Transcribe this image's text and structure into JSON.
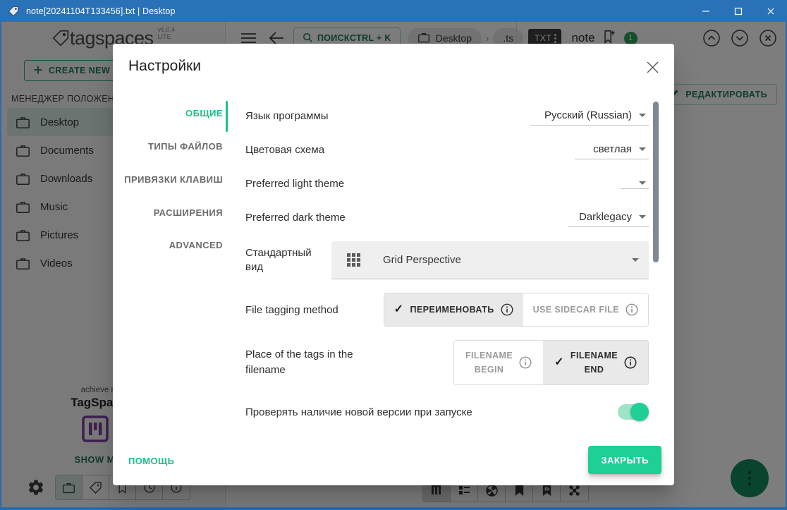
{
  "window": {
    "title": "note[20241104T133456].txt | Desktop",
    "icon": "tag-icon",
    "controls": {
      "minimize": "minimize-icon",
      "maximize": "maximize-icon",
      "close": "close-icon"
    },
    "titlebar_color": "#2a72b8"
  },
  "app": {
    "logo_text": "tagspaces",
    "version": "v6.0.4",
    "edition": "LITE",
    "create_new_label": "CREATE NEW",
    "locations_title": "МЕНЕДЖЕР ПОЛОЖЕНИЙ",
    "locations": [
      {
        "label": "Desktop",
        "icon": "briefcase-icon",
        "selected": true
      },
      {
        "label": "Documents",
        "icon": "briefcase-icon",
        "selected": false
      },
      {
        "label": "Downloads",
        "icon": "briefcase-icon",
        "selected": false
      },
      {
        "label": "Music",
        "icon": "briefcase-icon",
        "selected": false
      },
      {
        "label": "Pictures",
        "icon": "briefcase-icon",
        "selected": false
      },
      {
        "label": "Videos",
        "icon": "briefcase-icon",
        "selected": false
      }
    ],
    "promo": {
      "line1": "achieve more with",
      "line2": "TagSpaces Pro",
      "cta": "SHOW ME MORE"
    },
    "toolbar": {
      "menu_icon": "hamburger-menu-icon",
      "back_icon": "arrow-left-icon",
      "search_label": "ПОИСКCTRL + K",
      "search_icon": "search-icon",
      "breadcrumb": [
        {
          "label": "Desktop",
          "icon": "briefcase-icon"
        },
        {
          "label": ".ts",
          "icon": null
        }
      ],
      "breadcrumb_separator": "›"
    },
    "file_header": {
      "extension": "TXT",
      "name": "note",
      "bookmark_icon": "bookmark-add-icon",
      "tag_count": "1",
      "edit_label": "РЕДАКТИРОВАТЬ",
      "edit_icon": "pencil-icon",
      "nav_up_icon": "chevron-up-circle-icon",
      "nav_down_icon": "chevron-down-circle-icon",
      "nav_close_icon": "close-circle-icon"
    },
    "perspective_buttons": [
      "grid-perspective-icon",
      "list-perspective-icon",
      "gallery-perspective-icon",
      "kanban-perspective-icon",
      "mapique-perspective-icon",
      "folderviz-perspective-icon"
    ],
    "bottom_bar": {
      "settings_icon": "gear-icon",
      "buttons": [
        "briefcase-icon",
        "tag-icon",
        "bookmark-icon",
        "history-icon",
        "info-icon"
      ]
    },
    "fab_icon": "more-vertical-icon"
  },
  "dialog": {
    "title": "Настройки",
    "close_icon": "close-icon",
    "tabs": [
      {
        "label": "ОБЩИЕ",
        "active": true
      },
      {
        "label": "ТИПЫ ФАЙЛОВ",
        "active": false
      },
      {
        "label": "ПРИВЯЗКИ КЛАВИШ",
        "active": false
      },
      {
        "label": "РАСШИРЕНИЯ",
        "active": false
      },
      {
        "label": "ADVANCED",
        "active": false
      }
    ],
    "settings": {
      "language": {
        "label": "Язык программы",
        "value": "Русский (Russian)"
      },
      "color_scheme": {
        "label": "Цветовая схема",
        "value": "светлая"
      },
      "light_theme": {
        "label": "Preferred light theme",
        "value": ""
      },
      "dark_theme": {
        "label": "Preferred dark theme",
        "value": "Darklegacy"
      },
      "default_view": {
        "label": "Стандартный вид",
        "value": "Grid Perspective",
        "icon": "grid-icon"
      },
      "tagging_method": {
        "label": "File tagging method",
        "options": [
          {
            "label": "ПЕРЕИМЕНОВАТЬ",
            "selected": true
          },
          {
            "label": "USE SIDECAR FILE",
            "selected": false
          }
        ]
      },
      "tag_place": {
        "label": "Place of the tags in the filename",
        "options": [
          {
            "line1": "FILENAME",
            "line2": "BEGIN",
            "selected": false
          },
          {
            "line1": "FILENAME",
            "line2": "END",
            "selected": true
          }
        ]
      },
      "check_updates": {
        "label": "Проверять наличие новой версии при запуске",
        "enabled": true
      }
    },
    "footer": {
      "help_label": "ПОМОЩЬ",
      "close_label": "ЗАКРЫТЬ"
    }
  },
  "colors": {
    "accent": "#1ecf96",
    "accent_dark": "#1d7a55",
    "titlebar": "#2a72b8",
    "tag_badge": "#2e9e5b"
  }
}
